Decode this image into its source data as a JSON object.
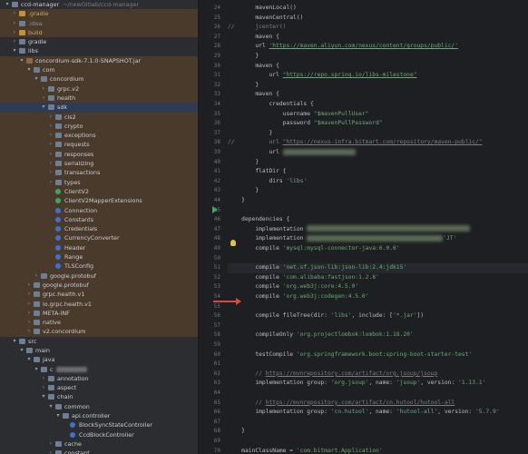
{
  "project_tree": {
    "rows": [
      {
        "indent": 0,
        "twist": "▾",
        "icon": "folder",
        "label": "ccd-manager",
        "suffix": "~/newGitlab/ccd-manager",
        "highlight": false
      },
      {
        "indent": 1,
        "twist": "›",
        "icon": "folder-orange",
        "label": ".gradle",
        "color": "orange",
        "highlight": true
      },
      {
        "indent": 1,
        "twist": "›",
        "icon": "folder",
        "label": ".idea",
        "color": "dim",
        "highlight": true
      },
      {
        "indent": 1,
        "twist": "›",
        "icon": "folder-orange",
        "label": "build",
        "color": "orange",
        "highlight": true
      },
      {
        "indent": 1,
        "twist": "›",
        "icon": "folder",
        "label": "gradle",
        "highlight": false
      },
      {
        "indent": 1,
        "twist": "▾",
        "icon": "folder",
        "label": "libs",
        "highlight": false
      },
      {
        "indent": 2,
        "twist": "▾",
        "icon": "jar",
        "label": "concordium-sdk-7.1.0-SNAPSHOT.jar",
        "highlight": true
      },
      {
        "indent": 3,
        "twist": "▾",
        "icon": "pkg",
        "label": "com",
        "highlight": true
      },
      {
        "indent": 4,
        "twist": "▾",
        "icon": "pkg",
        "label": "concordium",
        "highlight": true
      },
      {
        "indent": 5,
        "twist": "›",
        "icon": "pkg",
        "label": "grpc.v2",
        "highlight": true
      },
      {
        "indent": 5,
        "twist": "›",
        "icon": "pkg",
        "label": "health",
        "highlight": true
      },
      {
        "indent": 5,
        "twist": "▾",
        "icon": "pkg",
        "label": "sdk",
        "highlight": false,
        "selected": true
      },
      {
        "indent": 6,
        "twist": "›",
        "icon": "pkg",
        "label": "cis2",
        "highlight": true
      },
      {
        "indent": 6,
        "twist": "›",
        "icon": "pkg",
        "label": "crypto",
        "highlight": true
      },
      {
        "indent": 6,
        "twist": "›",
        "icon": "pkg",
        "label": "exceptions",
        "highlight": true
      },
      {
        "indent": 6,
        "twist": "›",
        "icon": "pkg",
        "label": "requests",
        "highlight": true
      },
      {
        "indent": 6,
        "twist": "›",
        "icon": "pkg",
        "label": "responses",
        "highlight": true
      },
      {
        "indent": 6,
        "twist": "›",
        "icon": "pkg",
        "label": "serializing",
        "highlight": true
      },
      {
        "indent": 6,
        "twist": "›",
        "icon": "pkg",
        "label": "transactions",
        "highlight": true
      },
      {
        "indent": 6,
        "twist": "›",
        "icon": "pkg",
        "label": "types",
        "highlight": true
      },
      {
        "indent": 6,
        "twist": "",
        "icon": "class-green",
        "label": "ClientV2",
        "highlight": true
      },
      {
        "indent": 6,
        "twist": "",
        "icon": "class-green",
        "label": "ClientV2MapperExtensions",
        "highlight": true
      },
      {
        "indent": 6,
        "twist": "",
        "icon": "class",
        "label": "Connection",
        "highlight": true
      },
      {
        "indent": 6,
        "twist": "",
        "icon": "class",
        "label": "Constants",
        "highlight": true
      },
      {
        "indent": 6,
        "twist": "",
        "icon": "class",
        "label": "Credentials",
        "highlight": true
      },
      {
        "indent": 6,
        "twist": "",
        "icon": "class",
        "label": "CurrencyConverter",
        "highlight": true
      },
      {
        "indent": 6,
        "twist": "",
        "icon": "class",
        "label": "Header",
        "highlight": true
      },
      {
        "indent": 6,
        "twist": "",
        "icon": "class",
        "label": "Range",
        "highlight": true
      },
      {
        "indent": 6,
        "twist": "",
        "icon": "class",
        "label": "TLSConfig",
        "highlight": true
      },
      {
        "indent": 4,
        "twist": "›",
        "icon": "pkg",
        "label": "google.protobuf",
        "highlight": true
      },
      {
        "indent": 3,
        "twist": "›",
        "icon": "pkg",
        "label": "google.protobuf",
        "highlight": true
      },
      {
        "indent": 3,
        "twist": "›",
        "icon": "pkg",
        "label": "grpc.health.v1",
        "highlight": true
      },
      {
        "indent": 3,
        "twist": "›",
        "icon": "pkg",
        "label": "io.grpc.health.v1",
        "highlight": true
      },
      {
        "indent": 3,
        "twist": "›",
        "icon": "folder",
        "label": "META-INF",
        "highlight": true
      },
      {
        "indent": 3,
        "twist": "›",
        "icon": "pkg",
        "label": "native",
        "highlight": true
      },
      {
        "indent": 3,
        "twist": "›",
        "icon": "pkg",
        "label": "v2.concordium",
        "highlight": true
      },
      {
        "indent": 1,
        "twist": "▾",
        "icon": "folder",
        "label": "src",
        "highlight": false
      },
      {
        "indent": 2,
        "twist": "▾",
        "icon": "folder",
        "label": "main",
        "highlight": false
      },
      {
        "indent": 3,
        "twist": "▾",
        "icon": "folder",
        "label": "java",
        "highlight": false
      },
      {
        "indent": 4,
        "twist": "▾",
        "icon": "pkg",
        "label": "c",
        "blurred": true,
        "highlight": false
      },
      {
        "indent": 5,
        "twist": "›",
        "icon": "pkg",
        "label": "annotation",
        "highlight": false
      },
      {
        "indent": 5,
        "twist": "›",
        "icon": "pkg",
        "label": "aspect",
        "highlight": false
      },
      {
        "indent": 5,
        "twist": "▾",
        "icon": "pkg",
        "label": "chain",
        "highlight": false
      },
      {
        "indent": 6,
        "twist": "▾",
        "icon": "pkg",
        "label": "common",
        "highlight": false
      },
      {
        "indent": 7,
        "twist": "▾",
        "icon": "pkg",
        "label": "api.controller",
        "highlight": false
      },
      {
        "indent": 8,
        "twist": "",
        "icon": "class",
        "label": "BlockSyncStateController",
        "highlight": false
      },
      {
        "indent": 8,
        "twist": "",
        "icon": "class",
        "label": "CcdBlockController",
        "highlight": false
      },
      {
        "indent": 6,
        "twist": "›",
        "icon": "pkg",
        "label": "cache",
        "highlight": false
      },
      {
        "indent": 6,
        "twist": "›",
        "icon": "pkg",
        "label": "constant",
        "highlight": false
      }
    ]
  },
  "editor": {
    "lines": [
      {
        "n": "24",
        "html": "        mavenLocal()"
      },
      {
        "n": "25",
        "html": "        mavenCentral()"
      },
      {
        "n": "26",
        "html": "//      jcenter()",
        "cls": "cm"
      },
      {
        "n": "27",
        "html": "        maven {"
      },
      {
        "n": "28",
        "parts": [
          [
            "        url ",
            ""
          ],
          [
            "'https://maven.aliyun.com/nexus/content/groups/public/'",
            "link"
          ]
        ]
      },
      {
        "n": "29",
        "html": "        }"
      },
      {
        "n": "30",
        "html": "        maven {"
      },
      {
        "n": "31",
        "parts": [
          [
            "            url ",
            ""
          ],
          [
            "\"https://repo.spring.io/libs-milestone\"",
            "link"
          ]
        ]
      },
      {
        "n": "32",
        "html": "        }"
      },
      {
        "n": "33",
        "html": "        maven {"
      },
      {
        "n": "34",
        "html": "            credentials {"
      },
      {
        "n": "35",
        "parts": [
          [
            "                username ",
            ""
          ],
          [
            "\"$mavenPullUser\"",
            "str"
          ]
        ]
      },
      {
        "n": "36",
        "parts": [
          [
            "                password ",
            ""
          ],
          [
            "\"$mavenPullPassword\"",
            "str"
          ]
        ]
      },
      {
        "n": "37",
        "html": "            }"
      },
      {
        "n": "38",
        "parts": [
          [
            "//          url ",
            "cm"
          ],
          [
            "\"https://nexus-infra.bitmart.com/repository/maven-public/\"",
            "cmlink"
          ]
        ]
      },
      {
        "n": "39",
        "parts": [
          [
            "            url ",
            ""
          ]
        ],
        "blur": 80
      },
      {
        "n": "40",
        "html": "        }"
      },
      {
        "n": "41",
        "html": "        flatDir {"
      },
      {
        "n": "42",
        "parts": [
          [
            "            dirs ",
            ""
          ],
          [
            "'libs'",
            "str"
          ]
        ]
      },
      {
        "n": "43",
        "html": "        }"
      },
      {
        "n": "44",
        "html": "    }"
      },
      {
        "n": "45",
        "html": ""
      },
      {
        "n": "46",
        "html": "    dependencies {"
      },
      {
        "n": "47",
        "parts": [
          [
            "        implementation ",
            ""
          ]
        ],
        "blur": 180
      },
      {
        "n": "48",
        "parts": [
          [
            "        implementation ",
            ""
          ]
        ],
        "blur": 150,
        "tail": "'JT'"
      },
      {
        "n": "49",
        "parts": [
          [
            "        compile ",
            ""
          ],
          [
            "'mysql:mysql-connector-java:6.0.6'",
            "str"
          ]
        ]
      },
      {
        "n": "50",
        "html": ""
      },
      {
        "n": "51",
        "parts": [
          [
            "        compile ",
            ""
          ],
          [
            "'net.sf.json-lib:json-lib:2.4:jdk15'",
            "str"
          ]
        ],
        "current": true
      },
      {
        "n": "52",
        "parts": [
          [
            "        compile ",
            ""
          ],
          [
            "'com.alibaba:fastjson:1.2.8'",
            "str"
          ]
        ]
      },
      {
        "n": "53",
        "parts": [
          [
            "        compile ",
            ""
          ],
          [
            "'org.web3j:core:4.5.0'",
            "str"
          ]
        ]
      },
      {
        "n": "54",
        "parts": [
          [
            "        compile ",
            ""
          ],
          [
            "'org.web3j:codegen:4.5.0'",
            "str"
          ]
        ]
      },
      {
        "n": "55",
        "html": ""
      },
      {
        "n": "56",
        "parts": [
          [
            "        compile fileTree(dir: ",
            ""
          ],
          [
            "'libs'",
            "str"
          ],
          [
            ", include: [",
            ""
          ],
          [
            "'*.jar'",
            "str"
          ],
          [
            "])",
            ""
          ]
        ]
      },
      {
        "n": "57",
        "html": ""
      },
      {
        "n": "58",
        "parts": [
          [
            "        compileOnly ",
            ""
          ],
          [
            "'org.projectlombok:lombok:1.18.20'",
            "str"
          ]
        ]
      },
      {
        "n": "59",
        "html": ""
      },
      {
        "n": "60",
        "parts": [
          [
            "        testCompile ",
            ""
          ],
          [
            "'org.springframework.boot:spring-boot-starter-test'",
            "str"
          ]
        ]
      },
      {
        "n": "61",
        "html": ""
      },
      {
        "n": "62",
        "parts": [
          [
            "        // ",
            "cm"
          ],
          [
            "https://mvnrepository.com/artifact/org.jsoup/jsoup",
            "cmlink"
          ]
        ]
      },
      {
        "n": "63",
        "parts": [
          [
            "        implementation group: ",
            ""
          ],
          [
            "'org.jsoup'",
            "str"
          ],
          [
            ", name: ",
            ""
          ],
          [
            "'jsoup'",
            "str"
          ],
          [
            ", version: ",
            ""
          ],
          [
            "'1.13.1'",
            "str"
          ]
        ]
      },
      {
        "n": "64",
        "html": ""
      },
      {
        "n": "65",
        "parts": [
          [
            "        // ",
            "cm"
          ],
          [
            "https://mvnrepository.com/artifact/cn.hutool/hutool-all",
            "cmlink"
          ]
        ]
      },
      {
        "n": "66",
        "parts": [
          [
            "        implementation group: ",
            ""
          ],
          [
            "'cn.hutool'",
            "str"
          ],
          [
            ", name: ",
            ""
          ],
          [
            "'hutool-all'",
            "str"
          ],
          [
            ", version: ",
            ""
          ],
          [
            "'5.7.9'",
            "str"
          ]
        ]
      },
      {
        "n": "67",
        "html": ""
      },
      {
        "n": "68",
        "html": "    }"
      },
      {
        "n": "69",
        "html": ""
      },
      {
        "n": "70",
        "parts": [
          [
            "    mainClassName",
            ""
          ],
          [
            " = ",
            ""
          ],
          [
            "'com.bitmart.Application'",
            "str"
          ]
        ]
      }
    ]
  }
}
